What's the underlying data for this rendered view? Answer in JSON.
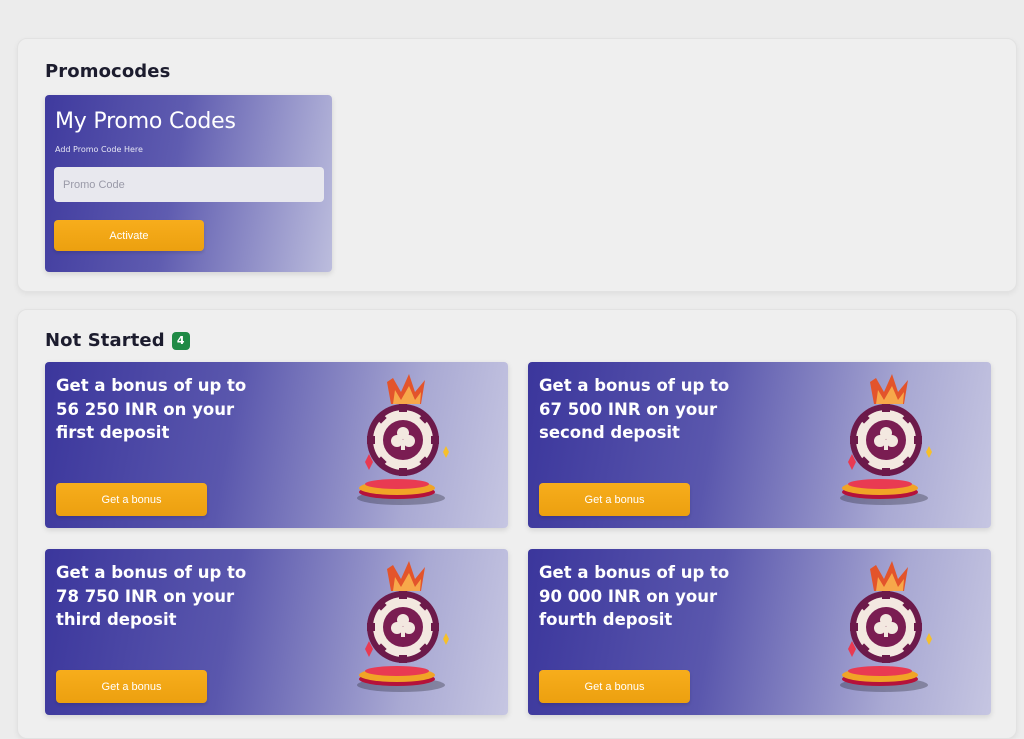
{
  "promocodes": {
    "section_title": "Promocodes",
    "card_title": "My Promo Codes",
    "card_subtitle": "Add Promo Code Here",
    "input_placeholder": "Promo Code",
    "input_value": "",
    "activate_label": "Activate"
  },
  "not_started": {
    "section_title": "Not Started",
    "count": "4",
    "cards": [
      {
        "title": "Get a bonus of up to 56 250 INR on your first deposit",
        "button_label": "Get a bonus",
        "icon": "casino-chip-crown-icon"
      },
      {
        "title": "Get a bonus of up to 67 500 INR on your second deposit",
        "button_label": "Get a bonus",
        "icon": "casino-chip-crown-icon"
      },
      {
        "title": "Get a bonus of up to 78 750 INR on your third deposit",
        "button_label": "Get a bonus",
        "icon": "casino-chip-crown-icon"
      },
      {
        "title": "Get a bonus of up to 90 000 INR on your fourth deposit",
        "button_label": "Get a bonus",
        "icon": "casino-chip-crown-icon"
      }
    ]
  },
  "colors": {
    "accent_button": "#f0a514",
    "card_gradient_start": "#3b369c",
    "card_gradient_end": "#c6c6e2",
    "badge": "#1f8a45"
  }
}
